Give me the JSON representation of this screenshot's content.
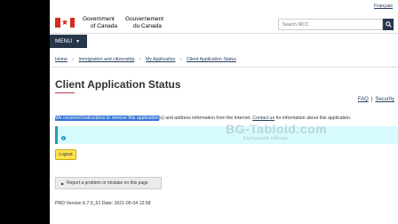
{
  "header": {
    "language_link": "Français",
    "government_en_line1": "Government",
    "government_en_line2": "of Canada",
    "government_fr_line1": "Gouvernement",
    "government_fr_line2": "du Canada",
    "search_placeholder": "Search IRCC"
  },
  "menu": {
    "label": "MENU"
  },
  "breadcrumb": {
    "items": [
      "Home",
      "Immigration and citizenship",
      "My Application",
      "Client Application Status"
    ]
  },
  "page": {
    "title": "Client Application Status",
    "faq_link": "FAQ",
    "separator": "|",
    "security_link": "Security"
  },
  "message": {
    "highlighted": "We received instructions to remove this application",
    "rest": "(s) and address information from the Internet.",
    "contact_link": "Contact us",
    "tail": "for information about this application."
  },
  "watermark": {
    "text": "BG-Tabloid.com",
    "subtext": "Българският таблоид"
  },
  "buttons": {
    "logout": "Logout",
    "report": "Report a problem or mistake on this page"
  },
  "footer": {
    "version": "PRD Version 6.7.0_61 Date: 2021-05-04 12:58"
  },
  "colors": {
    "accent_navy": "#26374a",
    "logout_yellow": "#ffe24f",
    "alert_bg": "#d7faff"
  }
}
